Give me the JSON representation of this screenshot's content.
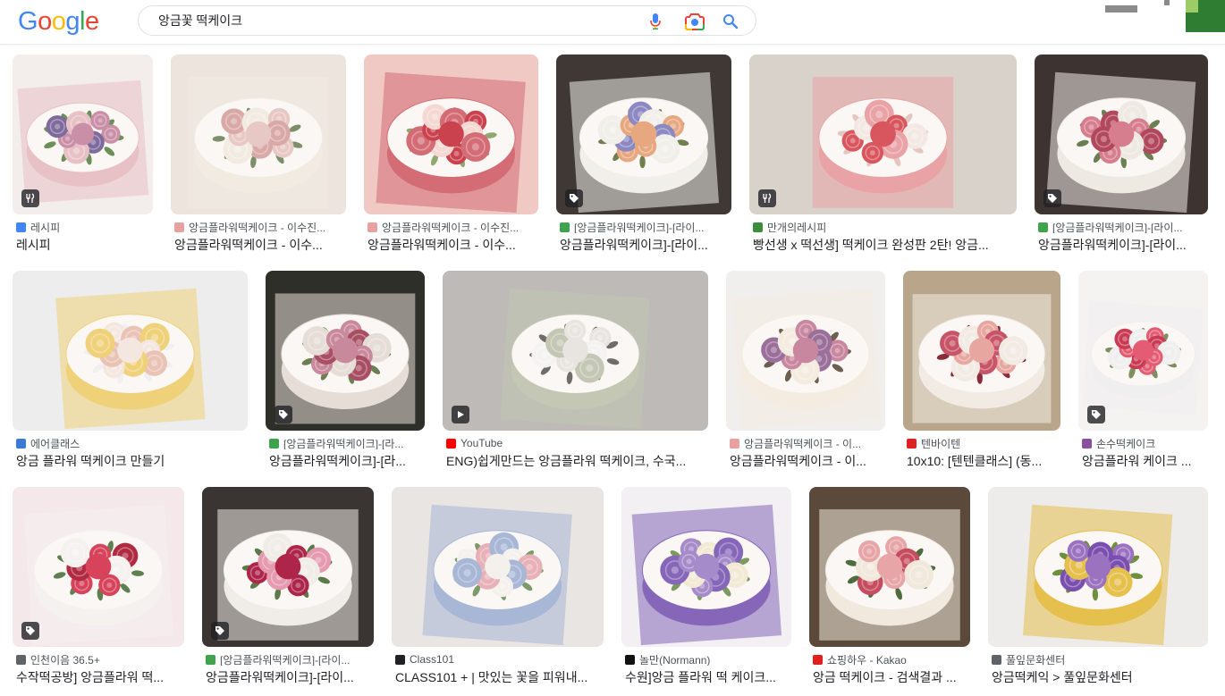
{
  "search": {
    "query": "앙금꽃 떡케이크"
  },
  "logo": {
    "letters": [
      "G",
      "o",
      "o",
      "g",
      "l",
      "e"
    ],
    "colors": [
      "#4285f4",
      "#ea4335",
      "#fbbc05",
      "#4285f4",
      "#34a853",
      "#ea4335"
    ]
  },
  "colors": {
    "badge_bg": "#3c4043",
    "accent": "#1a73e8"
  },
  "results": [
    {
      "source": "레시피",
      "title": "레시피",
      "badge": "fork-knife-icon",
      "favicon": "#4285f4",
      "palette": [
        "#f3eeec",
        "#c98fa7",
        "#7e6a9c",
        "#e7c1c6",
        "#6c8f5a"
      ]
    },
    {
      "source": "앙금플라워떡케이크 - 이수진...",
      "title": "앙금플라워떡케이크 - 이수...",
      "badge": "",
      "favicon": "#e8a0a0",
      "palette": [
        "#ece4dd",
        "#e8c8c4",
        "#d9a9a7",
        "#f1ebe2",
        "#7c8f6a"
      ]
    },
    {
      "source": "앙금플라워떡케이크 - 이수진...",
      "title": "앙금플라워떡케이크 - 이수...",
      "badge": "",
      "favicon": "#e8a0a0",
      "palette": [
        "#f0c9c4",
        "#c9424e",
        "#f5d8d2",
        "#d36c74",
        "#8fa870"
      ]
    },
    {
      "source": "[앙금플라워떡케이크]-[라이...",
      "title": "앙금플라워떡케이크]-[라이...",
      "badge": "tag-icon",
      "favicon": "#3fa34d",
      "palette": [
        "#3f3834",
        "#e7a87f",
        "#8c88c2",
        "#f1efe9",
        "#6f7f50"
      ]
    },
    {
      "source": "만개의레시피",
      "title": "빵선생 x 떡선생] 떡케이크 완성판 2탄! 앙금...",
      "badge": "fork-knife-icon",
      "favicon": "#3b8e3e",
      "palette": [
        "#d9d2cb",
        "#d8565e",
        "#f3e8e4",
        "#e9a3a6",
        "#e6c6c0"
      ]
    },
    {
      "source": "[앙금플라워떡케이크]-[라이...",
      "title": "앙금플라워떡케이크]-[라이...",
      "badge": "tag-icon",
      "favicon": "#3fa34d",
      "palette": [
        "#3d3431",
        "#d67d8e",
        "#b2485d",
        "#efe9e4",
        "#6b7f52"
      ]
    },
    {
      "source": "에어클래스",
      "title": "앙금 플라워 떡케이크 만들기",
      "badge": "",
      "favicon": "#3a7bd5",
      "palette": [
        "#ededed",
        "#f4e7e0",
        "#e9c3b5",
        "#efd17a",
        "#f0f0f0"
      ]
    },
    {
      "source": "[앙금플라워떡케이크]-[라...",
      "title": "앙금플라워떡케이크]-[라...",
      "badge": "tag-icon",
      "favicon": "#3fa34d",
      "palette": [
        "#2f2f2a",
        "#c9899c",
        "#a84f63",
        "#e5ddd6",
        "#6b7f52"
      ]
    },
    {
      "source": "YouTube",
      "title": "ENG)쉽게만드는 앙금플라워 떡케이크, 수국...",
      "badge": "play-icon",
      "favicon": "#ff0000",
      "palette": [
        "#bdbab8",
        "#e8e5e1",
        "#f4f3f1",
        "#c3c7b3",
        "#6f6d6a"
      ]
    },
    {
      "source": "앙금플라워떡케이크 - 이...",
      "title": "앙금플라워떡케이크 - 이...",
      "badge": "",
      "favicon": "#e8a0a0",
      "palette": [
        "#f1eeee",
        "#c9869f",
        "#9a6f9a",
        "#f4ece1",
        "#6c5f4f"
      ]
    },
    {
      "source": "텐바이텐",
      "title": "10x10: [텐텐클래스] (동...",
      "badge": "",
      "favicon": "#e02020",
      "palette": [
        "#b9a68a",
        "#e8a6a0",
        "#c85467",
        "#f2ebe4",
        "#8a2a3a"
      ]
    },
    {
      "source": "손수떡케이크",
      "title": "앙금플라워 케이크 ...",
      "badge": "tag-icon",
      "favicon": "#8a4fa0",
      "palette": [
        "#f5f2f2",
        "#e35c73",
        "#c93b52",
        "#efefef",
        "#7d8f5e"
      ]
    },
    {
      "source": "인천이음 36.5+",
      "title": "수작떡공방] 앙금플라워 떡...",
      "badge": "tag-icon",
      "favicon": "#5f6368",
      "palette": [
        "#f4e8ea",
        "#d6435a",
        "#b02b42",
        "#f5f1ef",
        "#5e7f4f"
      ]
    },
    {
      "source": "[앙금플라워떡케이크]-[라이...",
      "title": "앙금플라워떡케이크]-[라이...",
      "badge": "tag-icon",
      "favicon": "#3fa34d",
      "palette": [
        "#3a3432",
        "#ad2548",
        "#e59aaf",
        "#f0ece8",
        "#5a7a4a"
      ]
    },
    {
      "source": "Class101",
      "title": "CLASS101 + | 맛있는 꽃을 피워내...",
      "badge": "",
      "favicon": "#202124",
      "palette": [
        "#e9e5e2",
        "#f4f1ed",
        "#e7b1b7",
        "#a8b7d6",
        "#7c9a6a"
      ]
    },
    {
      "source": "놀만(Normann)",
      "title": "수원]앙금 플라워 떡 케이크...",
      "badge": "",
      "favicon": "#111111",
      "palette": [
        "#f2f0f2",
        "#a58bc9",
        "#f3ead6",
        "#8566b8",
        "#7b9a5e"
      ]
    },
    {
      "source": "쇼핑하우 - Kakao",
      "title": "앙금 떡케이크 - 검색결과 ...",
      "badge": "",
      "favicon": "#e02020",
      "palette": [
        "#5b4a3c",
        "#e7a5a8",
        "#c64d5f",
        "#f1e9dd",
        "#4f6a3c"
      ]
    },
    {
      "source": "풀잎문화센터",
      "title": "앙금떡케익 > 풀잎문화센터",
      "badge": "",
      "favicon": "#5f6368",
      "palette": [
        "#eeeceb",
        "#9b72c0",
        "#7b4fb0",
        "#e5c04d",
        "#6f8f3f"
      ]
    }
  ]
}
